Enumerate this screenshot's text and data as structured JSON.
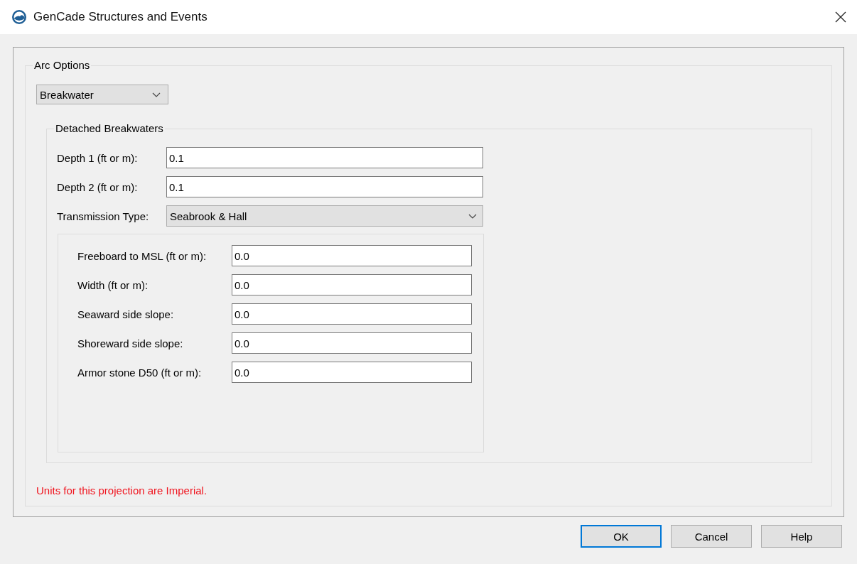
{
  "window": {
    "title": "GenCade Structures and Events"
  },
  "arc_options": {
    "label": "Arc Options",
    "arc_type": "Breakwater"
  },
  "detached_breakwaters": {
    "label": "Detached Breakwaters",
    "fields": [
      {
        "label": "Depth 1 (ft or m):",
        "value": "0.1"
      },
      {
        "label": "Depth 2 (ft or m):",
        "value": "0.1"
      }
    ],
    "transmission_type": {
      "label": "Transmission Type:",
      "value": "Seabrook & Hall"
    },
    "transmission_fields": [
      {
        "label": "Freeboard to MSL (ft or m):",
        "value": "0.0"
      },
      {
        "label": "Width (ft or m):",
        "value": "0.0"
      },
      {
        "label": "Seaward side slope:",
        "value": "0.0"
      },
      {
        "label": "Shoreward side slope:",
        "value": "0.0"
      },
      {
        "label": "Armor stone D50 (ft or m):",
        "value": "0.0"
      }
    ]
  },
  "units_note": "Units for this projection are Imperial.",
  "buttons": [
    {
      "label": "OK",
      "default": true
    },
    {
      "label": "Cancel",
      "default": false
    },
    {
      "label": "Help",
      "default": false
    }
  ]
}
